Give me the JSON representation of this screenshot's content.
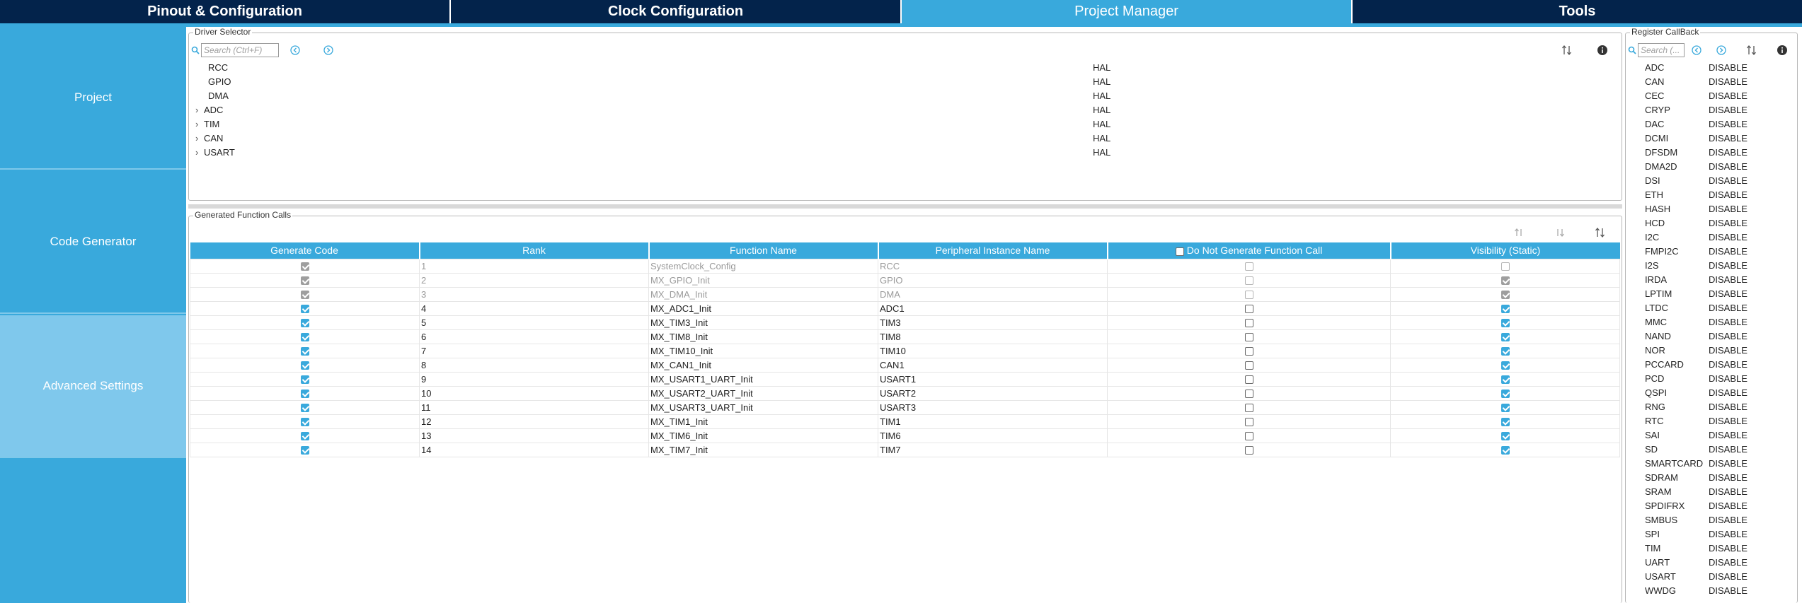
{
  "top_tabs": [
    {
      "label": "Pinout & Configuration",
      "active": false
    },
    {
      "label": "Clock Configuration",
      "active": false
    },
    {
      "label": "Project Manager",
      "active": true
    },
    {
      "label": "Tools",
      "active": false
    }
  ],
  "sidebar": {
    "items": [
      {
        "label": "Project",
        "active": false
      },
      {
        "label": "Code Generator",
        "active": false
      },
      {
        "label": "Advanced Settings",
        "active": true
      }
    ]
  },
  "driver_selector": {
    "title": "Driver Selector",
    "search_placeholder": "Search (Ctrl+F)",
    "rows": [
      {
        "name": "RCC",
        "value": "HAL",
        "expandable": false
      },
      {
        "name": "GPIO",
        "value": "HAL",
        "expandable": false
      },
      {
        "name": "DMA",
        "value": "HAL",
        "expandable": false
      },
      {
        "name": "ADC",
        "value": "HAL",
        "expandable": true
      },
      {
        "name": "TIM",
        "value": "HAL",
        "expandable": true
      },
      {
        "name": "CAN",
        "value": "HAL",
        "expandable": true
      },
      {
        "name": "USART",
        "value": "HAL",
        "expandable": true
      }
    ]
  },
  "generated_function_calls": {
    "title": "Generated Function Calls",
    "columns": [
      "Generate Code",
      "Rank",
      "Function Name",
      "Peripheral Instance Name",
      "Do Not Generate Function Call",
      "Visibility (Static)"
    ],
    "rows": [
      {
        "generate": true,
        "rank": "1",
        "function": "SystemClock_Config",
        "instance": "RCC",
        "do_not_generate": false,
        "visibility": false,
        "locked": true
      },
      {
        "generate": true,
        "rank": "2",
        "function": "MX_GPIO_Init",
        "instance": "GPIO",
        "do_not_generate": false,
        "visibility": true,
        "locked": true
      },
      {
        "generate": true,
        "rank": "3",
        "function": "MX_DMA_Init",
        "instance": "DMA",
        "do_not_generate": false,
        "visibility": true,
        "locked": true
      },
      {
        "generate": true,
        "rank": "4",
        "function": "MX_ADC1_Init",
        "instance": "ADC1",
        "do_not_generate": false,
        "visibility": true,
        "locked": false
      },
      {
        "generate": true,
        "rank": "5",
        "function": "MX_TIM3_Init",
        "instance": "TIM3",
        "do_not_generate": false,
        "visibility": true,
        "locked": false
      },
      {
        "generate": true,
        "rank": "6",
        "function": "MX_TIM8_Init",
        "instance": "TIM8",
        "do_not_generate": false,
        "visibility": true,
        "locked": false
      },
      {
        "generate": true,
        "rank": "7",
        "function": "MX_TIM10_Init",
        "instance": "TIM10",
        "do_not_generate": false,
        "visibility": true,
        "locked": false
      },
      {
        "generate": true,
        "rank": "8",
        "function": "MX_CAN1_Init",
        "instance": "CAN1",
        "do_not_generate": false,
        "visibility": true,
        "locked": false
      },
      {
        "generate": true,
        "rank": "9",
        "function": "MX_USART1_UART_Init",
        "instance": "USART1",
        "do_not_generate": false,
        "visibility": true,
        "locked": false
      },
      {
        "generate": true,
        "rank": "10",
        "function": "MX_USART2_UART_Init",
        "instance": "USART2",
        "do_not_generate": false,
        "visibility": true,
        "locked": false
      },
      {
        "generate": true,
        "rank": "11",
        "function": "MX_USART3_UART_Init",
        "instance": "USART3",
        "do_not_generate": false,
        "visibility": true,
        "locked": false
      },
      {
        "generate": true,
        "rank": "12",
        "function": "MX_TIM1_Init",
        "instance": "TIM1",
        "do_not_generate": false,
        "visibility": true,
        "locked": false
      },
      {
        "generate": true,
        "rank": "13",
        "function": "MX_TIM6_Init",
        "instance": "TIM6",
        "do_not_generate": false,
        "visibility": true,
        "locked": false
      },
      {
        "generate": true,
        "rank": "14",
        "function": "MX_TIM7_Init",
        "instance": "TIM7",
        "do_not_generate": false,
        "visibility": true,
        "locked": false
      }
    ]
  },
  "register_callback": {
    "title": "Register CallBack",
    "search_placeholder": "Search (...",
    "rows": [
      {
        "name": "ADC",
        "value": "DISABLE"
      },
      {
        "name": "CAN",
        "value": "DISABLE"
      },
      {
        "name": "CEC",
        "value": "DISABLE"
      },
      {
        "name": "CRYP",
        "value": "DISABLE"
      },
      {
        "name": "DAC",
        "value": "DISABLE"
      },
      {
        "name": "DCMI",
        "value": "DISABLE"
      },
      {
        "name": "DFSDM",
        "value": "DISABLE"
      },
      {
        "name": "DMA2D",
        "value": "DISABLE"
      },
      {
        "name": "DSI",
        "value": "DISABLE"
      },
      {
        "name": "ETH",
        "value": "DISABLE"
      },
      {
        "name": "HASH",
        "value": "DISABLE"
      },
      {
        "name": "HCD",
        "value": "DISABLE"
      },
      {
        "name": "I2C",
        "value": "DISABLE"
      },
      {
        "name": "FMPI2C",
        "value": "DISABLE"
      },
      {
        "name": "I2S",
        "value": "DISABLE"
      },
      {
        "name": "IRDA",
        "value": "DISABLE"
      },
      {
        "name": "LPTIM",
        "value": "DISABLE"
      },
      {
        "name": "LTDC",
        "value": "DISABLE"
      },
      {
        "name": "MMC",
        "value": "DISABLE"
      },
      {
        "name": "NAND",
        "value": "DISABLE"
      },
      {
        "name": "NOR",
        "value": "DISABLE"
      },
      {
        "name": "PCCARD",
        "value": "DISABLE"
      },
      {
        "name": "PCD",
        "value": "DISABLE"
      },
      {
        "name": "QSPI",
        "value": "DISABLE"
      },
      {
        "name": "RNG",
        "value": "DISABLE"
      },
      {
        "name": "RTC",
        "value": "DISABLE"
      },
      {
        "name": "SAI",
        "value": "DISABLE"
      },
      {
        "name": "SD",
        "value": "DISABLE"
      },
      {
        "name": "SMARTCARD",
        "value": "DISABLE"
      },
      {
        "name": "SDRAM",
        "value": "DISABLE"
      },
      {
        "name": "SRAM",
        "value": "DISABLE"
      },
      {
        "name": "SPDIFRX",
        "value": "DISABLE"
      },
      {
        "name": "SMBUS",
        "value": "DISABLE"
      },
      {
        "name": "SPI",
        "value": "DISABLE"
      },
      {
        "name": "TIM",
        "value": "DISABLE"
      },
      {
        "name": "UART",
        "value": "DISABLE"
      },
      {
        "name": "USART",
        "value": "DISABLE"
      },
      {
        "name": "WWDG",
        "value": "DISABLE"
      }
    ]
  },
  "icons": {
    "search": "search-icon",
    "expand_all": "expand-all-icon",
    "collapse_all": "collapse-all-icon",
    "sort": "sort-icon",
    "move_up": "move-up-icon",
    "move_down": "move-down-icon",
    "info": "info-icon"
  },
  "colors": {
    "nav_dark": "#03234b",
    "accent": "#39a9dc",
    "active_light": "#7fc8ec"
  }
}
